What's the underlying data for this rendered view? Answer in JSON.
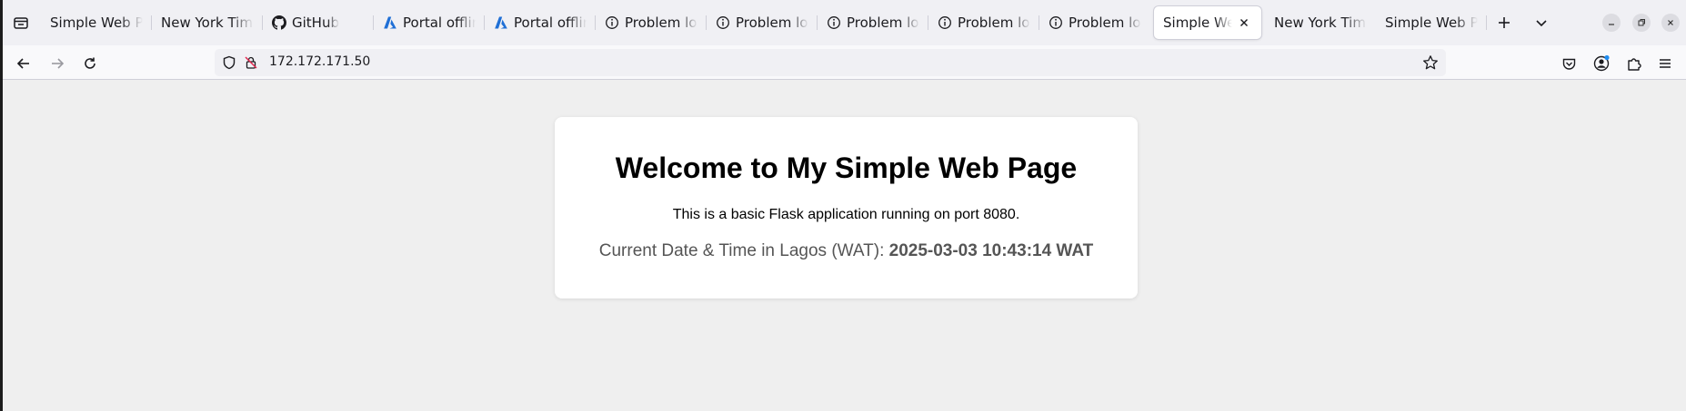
{
  "tabs": [
    {
      "title": "Simple Web Page",
      "icon": "none",
      "width": 122,
      "active": false
    },
    {
      "title": "New York Times",
      "icon": "none",
      "width": 122,
      "active": false
    },
    {
      "title": "GitHub",
      "icon": "github-icon",
      "width": 122,
      "active": false
    },
    {
      "title": "Portal offline",
      "icon": "azure-icon",
      "width": 122,
      "active": false
    },
    {
      "title": "Portal offline",
      "icon": "azure-icon",
      "width": 122,
      "active": false
    },
    {
      "title": "Problem loading page",
      "icon": "info-icon",
      "width": 122,
      "active": false
    },
    {
      "title": "Problem loading page",
      "icon": "info-icon",
      "width": 122,
      "active": false
    },
    {
      "title": "Problem loading page",
      "icon": "info-icon",
      "width": 122,
      "active": false
    },
    {
      "title": "Problem loading page",
      "icon": "info-icon",
      "width": 122,
      "active": false
    },
    {
      "title": "Problem loading page",
      "icon": "info-icon",
      "width": 122,
      "active": false
    },
    {
      "title": "Simple Web Page",
      "icon": "none",
      "width": 118,
      "active": true
    },
    {
      "title": "New York Times",
      "icon": "none",
      "width": 122,
      "active": false
    },
    {
      "title": "Simple Web Page",
      "icon": "none",
      "width": 122,
      "active": false
    }
  ],
  "nav": {
    "url": "172.172.171.50"
  },
  "page": {
    "heading": "Welcome to My Simple Web Page",
    "description": "This is a basic Flask application running on port 8080.",
    "datetime_label": "Current Date & Time in Lagos (WAT): ",
    "datetime_value": "2025-03-03 10:43:14 WAT"
  },
  "colors": {
    "tabstrip_bg": "#f0f0f4",
    "navbar_bg": "#f9f9fb",
    "page_bg": "#efefef",
    "card_bg": "#ffffff",
    "azure_blue": "#1f6fd6"
  }
}
